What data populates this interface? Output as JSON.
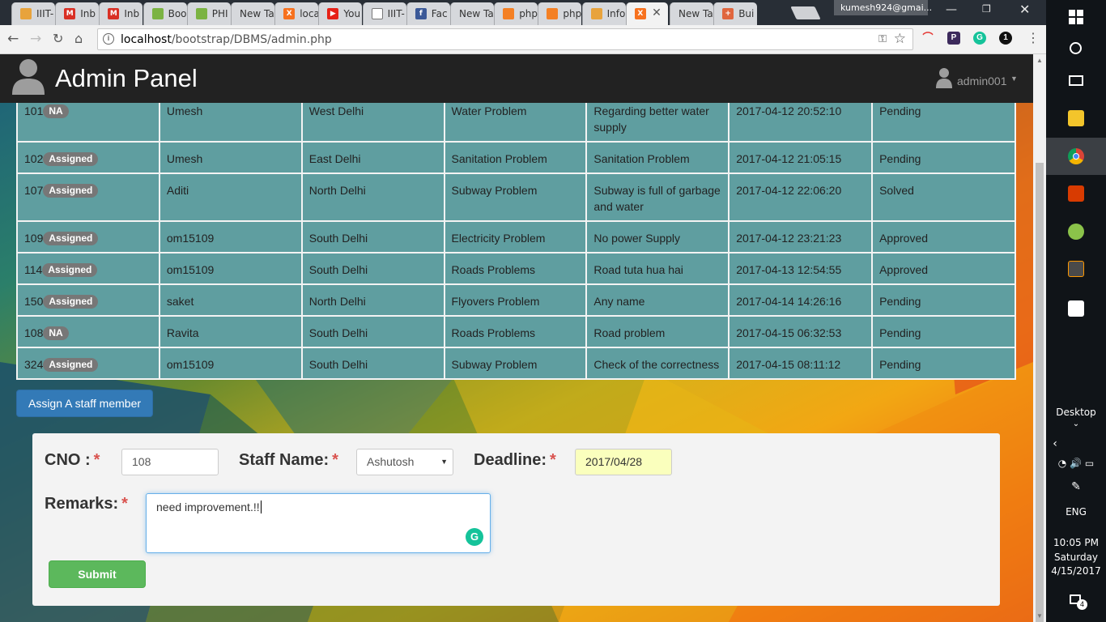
{
  "browser": {
    "tabs": [
      {
        "title": "IIIT-",
        "favicon_color": "#e8a33c",
        "favicon_glyph": "book"
      },
      {
        "title": "Inb",
        "favicon_color": "#d93025",
        "favicon_glyph": "M"
      },
      {
        "title": "Inb",
        "favicon_color": "#d93025",
        "favicon_glyph": "M"
      },
      {
        "title": "Boo",
        "favicon_color": "#7bb342",
        "favicon_glyph": "w3"
      },
      {
        "title": "PHI",
        "favicon_color": "#7bb342",
        "favicon_glyph": "w3"
      },
      {
        "title": "New Ta",
        "favicon_color": "",
        "favicon_glyph": ""
      },
      {
        "title": "loca",
        "favicon_color": "#f7711e",
        "favicon_glyph": "X"
      },
      {
        "title": "You",
        "favicon_color": "#e62117",
        "favicon_glyph": "▶"
      },
      {
        "title": "IIIT-",
        "favicon_color": "#ffffff",
        "favicon_glyph": "doc"
      },
      {
        "title": "Fac",
        "favicon_color": "#3b5998",
        "favicon_glyph": "f"
      },
      {
        "title": "New Ta",
        "favicon_color": "",
        "favicon_glyph": ""
      },
      {
        "title": "php",
        "favicon_color": "#f48024",
        "favicon_glyph": "so"
      },
      {
        "title": "php",
        "favicon_color": "#f48024",
        "favicon_glyph": "so"
      },
      {
        "title": "Info",
        "favicon_color": "#e8a33c",
        "favicon_glyph": "book"
      },
      {
        "title": "",
        "favicon_color": "#f7711e",
        "favicon_glyph": "X",
        "active": true
      },
      {
        "title": "New Ta",
        "favicon_color": "",
        "favicon_glyph": ""
      },
      {
        "title": "Bui",
        "favicon_color": "#e0663e",
        "favicon_glyph": "+"
      }
    ],
    "profile_name": "kumesh924@gmai...",
    "url_host": "localhost",
    "url_path": "/bootstrap/DBMS/admin.php"
  },
  "navbar": {
    "brand": "Admin Panel",
    "account": "admin001"
  },
  "table": {
    "rows": [
      {
        "cno": "101",
        "status_badge": "NA",
        "name": "Umesh",
        "area": "West Delhi",
        "type": "Water Problem",
        "description": "Regarding better water supply",
        "datetime": "2017-04-12 20:52:10",
        "status": "Pending",
        "tall": true
      },
      {
        "cno": "102",
        "status_badge": "Assigned",
        "name": "Umesh",
        "area": "East Delhi",
        "type": "Sanitation Problem",
        "description": "Sanitation Problem",
        "datetime": "2017-04-12 21:05:15",
        "status": "Pending",
        "tall": false
      },
      {
        "cno": "107",
        "status_badge": "Assigned",
        "name": "Aditi",
        "area": "North Delhi",
        "type": "Subway Problem",
        "description": "Subway is full of garbage and water",
        "datetime": "2017-04-12 22:06:20",
        "status": "Solved",
        "tall": true
      },
      {
        "cno": "109",
        "status_badge": "Assigned",
        "name": "om15109",
        "area": "South Delhi",
        "type": "Electricity Problem",
        "description": "No power Supply",
        "datetime": "2017-04-12 23:21:23",
        "status": "Approved",
        "tall": false
      },
      {
        "cno": "114",
        "status_badge": "Assigned",
        "name": "om15109",
        "area": "South Delhi",
        "type": "Roads Problems",
        "description": "Road tuta hua hai",
        "datetime": "2017-04-13 12:54:55",
        "status": "Approved",
        "tall": false
      },
      {
        "cno": "150",
        "status_badge": "Assigned",
        "name": "saket",
        "area": "North Delhi",
        "type": "Flyovers Problem",
        "description": "Any name",
        "datetime": "2017-04-14 14:26:16",
        "status": "Pending",
        "tall": false
      },
      {
        "cno": "108",
        "status_badge": "NA",
        "name": "Ravita",
        "area": "South Delhi",
        "type": "Roads Problems",
        "description": "Road problem",
        "datetime": "2017-04-15 06:32:53",
        "status": "Pending",
        "tall": false
      },
      {
        "cno": "324",
        "status_badge": "Assigned",
        "name": "om15109",
        "area": "South Delhi",
        "type": "Subway Problem",
        "description": "Check of the correctness",
        "datetime": "2017-04-15 08:11:12",
        "status": "Pending",
        "tall": false
      }
    ]
  },
  "assign_button": "Assign A staff member",
  "form": {
    "cno_label": "CNO :",
    "cno_value": "108",
    "staff_label": "Staff Name:",
    "staff_value": "Ashutosh",
    "deadline_label": "Deadline:",
    "deadline_value": "2017/04/28",
    "remarks_label": "Remarks:",
    "remarks_value": "need improvement.!!",
    "required_mark": "*",
    "submit_label": "Submit"
  },
  "taskbar": {
    "desktop_label": "Desktop",
    "language": "ENG",
    "time": "10:05 PM",
    "day": "Saturday",
    "date": "4/15/2017",
    "notification_count": "4"
  },
  "colors": {
    "table_bg": "#5f9ea0",
    "primary_button": "#337ab7",
    "success_button": "#5cb85c",
    "navbar_bg": "#222222",
    "required": "#d9534f"
  }
}
